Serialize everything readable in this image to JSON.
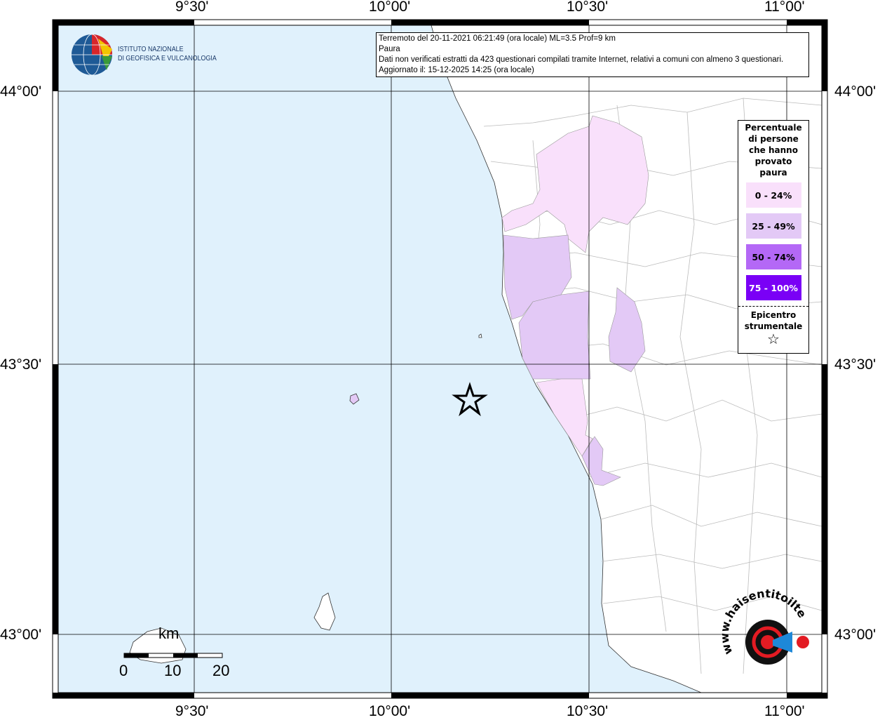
{
  "info": {
    "line1": "Terremoto del 20-11-2021 06:21:49 (ora locale) ML=3.5 Prof=9 km",
    "line2": "Paura",
    "line3": "Dati non verificati estratti da 423 questionari compilati tramite Internet, relativi a comuni con almeno 3 questionari.",
    "line4": "Aggiornato il: 15-12-2025 14:25 (ora locale)"
  },
  "logo": {
    "line1": "ISTITUTO NAZIONALE",
    "line2": "DI GEOFISICA E VULCANOLOGIA"
  },
  "axes": {
    "lon_ticks": [
      "9°30'",
      "10°00'",
      "10°30'",
      "11°00'"
    ],
    "lat_ticks": [
      "44°00'",
      "43°30'",
      "43°00'"
    ]
  },
  "legend": {
    "title": [
      "Percentuale",
      "di persone",
      "che hanno",
      "provato",
      "paura"
    ],
    "classes": [
      {
        "label": "0 - 24%",
        "color": "#f9e0fb"
      },
      {
        "label": "25 - 49%",
        "color": "#e3c9f6"
      },
      {
        "label": "50 - 74%",
        "color": "#b468f6"
      },
      {
        "label": "75 - 100%",
        "color": "#7a00f6"
      }
    ],
    "epicenter_label": [
      "Epicentro",
      "strumentale"
    ]
  },
  "scale": {
    "unit": "km",
    "labels": [
      "0",
      "10",
      "20"
    ]
  },
  "colors": {
    "sea": "#e0f1fc",
    "land": "#ffffff",
    "borders": "#b4b4b4"
  },
  "watermark": "www.haisentitoilterremoto.it"
}
